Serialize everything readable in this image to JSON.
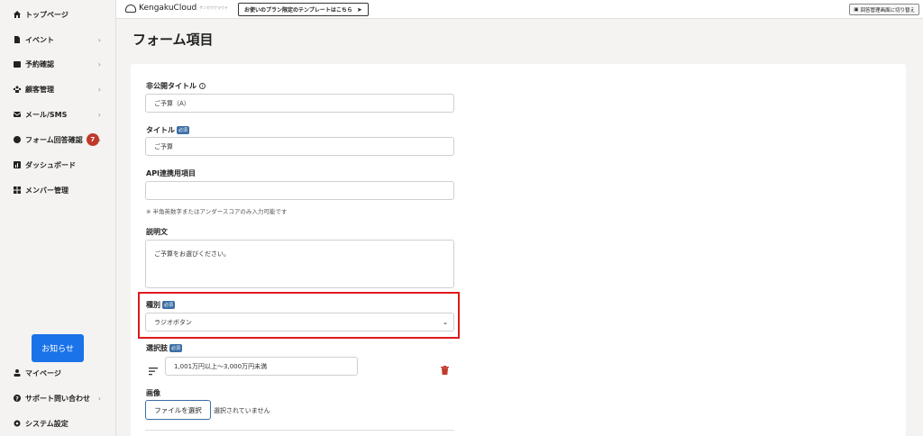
{
  "sidebar": {
    "items": [
      {
        "label": "トップページ",
        "icon": "home-icon"
      },
      {
        "label": "イベント",
        "icon": "document-icon"
      },
      {
        "label": "予約確認",
        "icon": "calendar-icon"
      },
      {
        "label": "顧客管理",
        "icon": "people-icon"
      },
      {
        "label": "メール/SMS",
        "icon": "mail-icon"
      },
      {
        "label": "フォーム回答確認",
        "icon": "chat-icon",
        "badge": "7"
      },
      {
        "label": "ダッシュボード",
        "icon": "chart-icon"
      },
      {
        "label": "メンバー管理",
        "icon": "grid-icon"
      }
    ],
    "notice_button": "お知らせ",
    "bottom_items": [
      {
        "label": "マイページ",
        "icon": "person-icon"
      },
      {
        "label": "サポート問い合わせ",
        "icon": "help-icon"
      },
      {
        "label": "システム設定",
        "icon": "gear-icon"
      }
    ]
  },
  "header": {
    "logo_text": "KengakuCloud",
    "logo_sub": "ケンガククラウド",
    "template_button": "お使いのプラン限定のテンプレートはこちら",
    "switch_button": "回答管理画面に切り替え"
  },
  "page": {
    "title": "フォーム項目"
  },
  "form": {
    "private_title": {
      "label": "非公開タイトル",
      "value": "ご予算（A）"
    },
    "title": {
      "label": "タイトル",
      "value": "ご予算"
    },
    "api_field": {
      "label": "API連携用項目",
      "value": "",
      "hint": "※ 半角英数字またはアンダースコアのみ入力可能です"
    },
    "description": {
      "label": "説明文",
      "value": "ご予算をお選びください。"
    },
    "type": {
      "label": "種別",
      "value": "ラジオボタン"
    },
    "choices": {
      "label": "選択肢",
      "value": "1,001万円以上～3,000万円未満"
    },
    "image": {
      "label": "画像",
      "button": "ファイルを選択",
      "status": "選択されていません"
    },
    "required_badge": "必須"
  },
  "colors": {
    "accent": "#1a73e8",
    "required_badge": "#3b6ea5",
    "highlight": "#e0191e",
    "delete": "#c0392b"
  }
}
